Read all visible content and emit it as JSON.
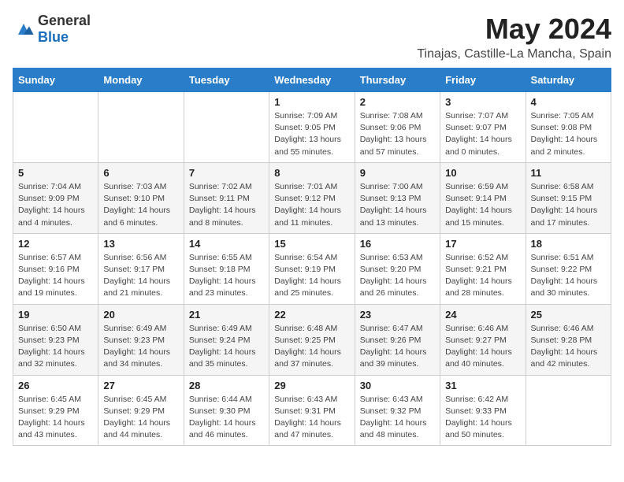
{
  "header": {
    "logo_general": "General",
    "logo_blue": "Blue",
    "main_title": "May 2024",
    "subtitle": "Tinajas, Castille-La Mancha, Spain"
  },
  "days_of_week": [
    "Sunday",
    "Monday",
    "Tuesday",
    "Wednesday",
    "Thursday",
    "Friday",
    "Saturday"
  ],
  "weeks": [
    {
      "days": [
        {
          "number": "",
          "info": ""
        },
        {
          "number": "",
          "info": ""
        },
        {
          "number": "",
          "info": ""
        },
        {
          "number": "1",
          "info": "Sunrise: 7:09 AM\nSunset: 9:05 PM\nDaylight: 13 hours\nand 55 minutes."
        },
        {
          "number": "2",
          "info": "Sunrise: 7:08 AM\nSunset: 9:06 PM\nDaylight: 13 hours\nand 57 minutes."
        },
        {
          "number": "3",
          "info": "Sunrise: 7:07 AM\nSunset: 9:07 PM\nDaylight: 14 hours\nand 0 minutes."
        },
        {
          "number": "4",
          "info": "Sunrise: 7:05 AM\nSunset: 9:08 PM\nDaylight: 14 hours\nand 2 minutes."
        }
      ]
    },
    {
      "days": [
        {
          "number": "5",
          "info": "Sunrise: 7:04 AM\nSunset: 9:09 PM\nDaylight: 14 hours\nand 4 minutes."
        },
        {
          "number": "6",
          "info": "Sunrise: 7:03 AM\nSunset: 9:10 PM\nDaylight: 14 hours\nand 6 minutes."
        },
        {
          "number": "7",
          "info": "Sunrise: 7:02 AM\nSunset: 9:11 PM\nDaylight: 14 hours\nand 8 minutes."
        },
        {
          "number": "8",
          "info": "Sunrise: 7:01 AM\nSunset: 9:12 PM\nDaylight: 14 hours\nand 11 minutes."
        },
        {
          "number": "9",
          "info": "Sunrise: 7:00 AM\nSunset: 9:13 PM\nDaylight: 14 hours\nand 13 minutes."
        },
        {
          "number": "10",
          "info": "Sunrise: 6:59 AM\nSunset: 9:14 PM\nDaylight: 14 hours\nand 15 minutes."
        },
        {
          "number": "11",
          "info": "Sunrise: 6:58 AM\nSunset: 9:15 PM\nDaylight: 14 hours\nand 17 minutes."
        }
      ]
    },
    {
      "days": [
        {
          "number": "12",
          "info": "Sunrise: 6:57 AM\nSunset: 9:16 PM\nDaylight: 14 hours\nand 19 minutes."
        },
        {
          "number": "13",
          "info": "Sunrise: 6:56 AM\nSunset: 9:17 PM\nDaylight: 14 hours\nand 21 minutes."
        },
        {
          "number": "14",
          "info": "Sunrise: 6:55 AM\nSunset: 9:18 PM\nDaylight: 14 hours\nand 23 minutes."
        },
        {
          "number": "15",
          "info": "Sunrise: 6:54 AM\nSunset: 9:19 PM\nDaylight: 14 hours\nand 25 minutes."
        },
        {
          "number": "16",
          "info": "Sunrise: 6:53 AM\nSunset: 9:20 PM\nDaylight: 14 hours\nand 26 minutes."
        },
        {
          "number": "17",
          "info": "Sunrise: 6:52 AM\nSunset: 9:21 PM\nDaylight: 14 hours\nand 28 minutes."
        },
        {
          "number": "18",
          "info": "Sunrise: 6:51 AM\nSunset: 9:22 PM\nDaylight: 14 hours\nand 30 minutes."
        }
      ]
    },
    {
      "days": [
        {
          "number": "19",
          "info": "Sunrise: 6:50 AM\nSunset: 9:23 PM\nDaylight: 14 hours\nand 32 minutes."
        },
        {
          "number": "20",
          "info": "Sunrise: 6:49 AM\nSunset: 9:23 PM\nDaylight: 14 hours\nand 34 minutes."
        },
        {
          "number": "21",
          "info": "Sunrise: 6:49 AM\nSunset: 9:24 PM\nDaylight: 14 hours\nand 35 minutes."
        },
        {
          "number": "22",
          "info": "Sunrise: 6:48 AM\nSunset: 9:25 PM\nDaylight: 14 hours\nand 37 minutes."
        },
        {
          "number": "23",
          "info": "Sunrise: 6:47 AM\nSunset: 9:26 PM\nDaylight: 14 hours\nand 39 minutes."
        },
        {
          "number": "24",
          "info": "Sunrise: 6:46 AM\nSunset: 9:27 PM\nDaylight: 14 hours\nand 40 minutes."
        },
        {
          "number": "25",
          "info": "Sunrise: 6:46 AM\nSunset: 9:28 PM\nDaylight: 14 hours\nand 42 minutes."
        }
      ]
    },
    {
      "days": [
        {
          "number": "26",
          "info": "Sunrise: 6:45 AM\nSunset: 9:29 PM\nDaylight: 14 hours\nand 43 minutes."
        },
        {
          "number": "27",
          "info": "Sunrise: 6:45 AM\nSunset: 9:29 PM\nDaylight: 14 hours\nand 44 minutes."
        },
        {
          "number": "28",
          "info": "Sunrise: 6:44 AM\nSunset: 9:30 PM\nDaylight: 14 hours\nand 46 minutes."
        },
        {
          "number": "29",
          "info": "Sunrise: 6:43 AM\nSunset: 9:31 PM\nDaylight: 14 hours\nand 47 minutes."
        },
        {
          "number": "30",
          "info": "Sunrise: 6:43 AM\nSunset: 9:32 PM\nDaylight: 14 hours\nand 48 minutes."
        },
        {
          "number": "31",
          "info": "Sunrise: 6:42 AM\nSunset: 9:33 PM\nDaylight: 14 hours\nand 50 minutes."
        },
        {
          "number": "",
          "info": ""
        }
      ]
    }
  ]
}
